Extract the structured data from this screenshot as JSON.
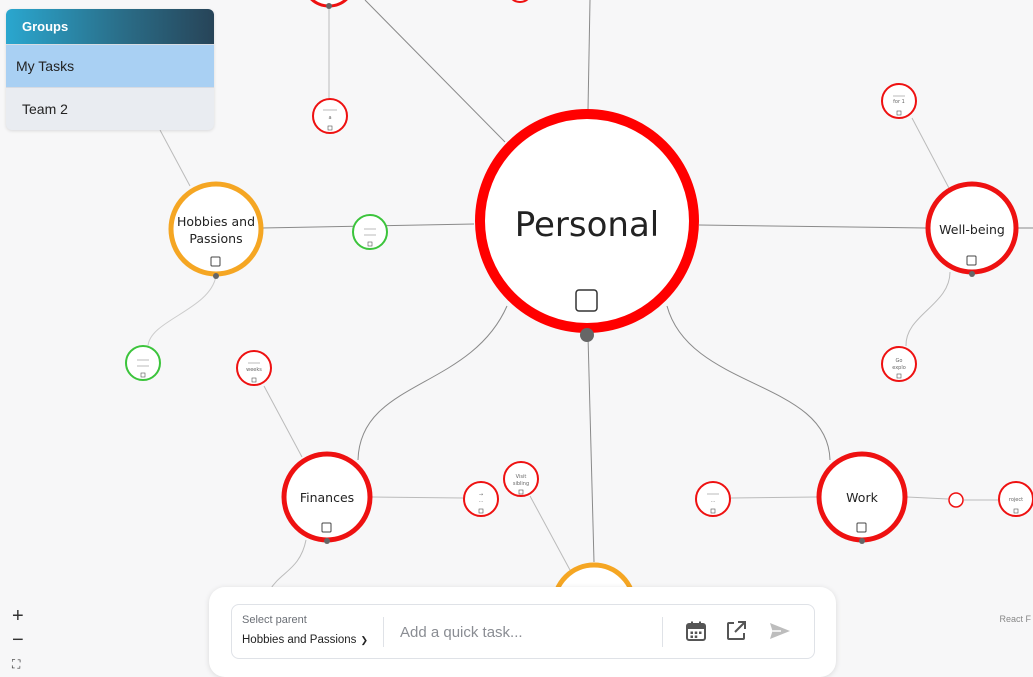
{
  "groups": {
    "header": "Groups",
    "items": [
      {
        "label": "My Tasks"
      },
      {
        "label": "Team 2"
      }
    ]
  },
  "mindmap": {
    "center": "Personal",
    "nodes": {
      "hobbies_line1": "Hobbies and",
      "hobbies_line2": "Passions",
      "wellbeing": "Well-being",
      "finances": "Finances",
      "work": "Work"
    },
    "small_labels": {
      "wb_top": "for 1",
      "wb_bottom_1": "Go",
      "wb_bottom_2": "explo",
      "fin_left": "weeks",
      "fin_right": "...",
      "visit_1": "Visit",
      "visit_2": "sibling",
      "work_left": "...",
      "work_right": "roject"
    }
  },
  "zoom_controls": {
    "plus": "+",
    "minus": "−",
    "fit": "⛶"
  },
  "attribution": "React F",
  "quick_task": {
    "parent_label": "Select parent",
    "parent_value": "Hobbies and Passions",
    "placeholder": "Add a quick task..."
  },
  "colors": {
    "red": "#ee1111",
    "orange": "#f5a623",
    "green": "#3cc43c",
    "edge": "#7a7a7a"
  },
  "icons": [
    "calendar-icon",
    "open-external-icon",
    "send-icon",
    "chevron-down-icon",
    "checkbox-icon"
  ]
}
